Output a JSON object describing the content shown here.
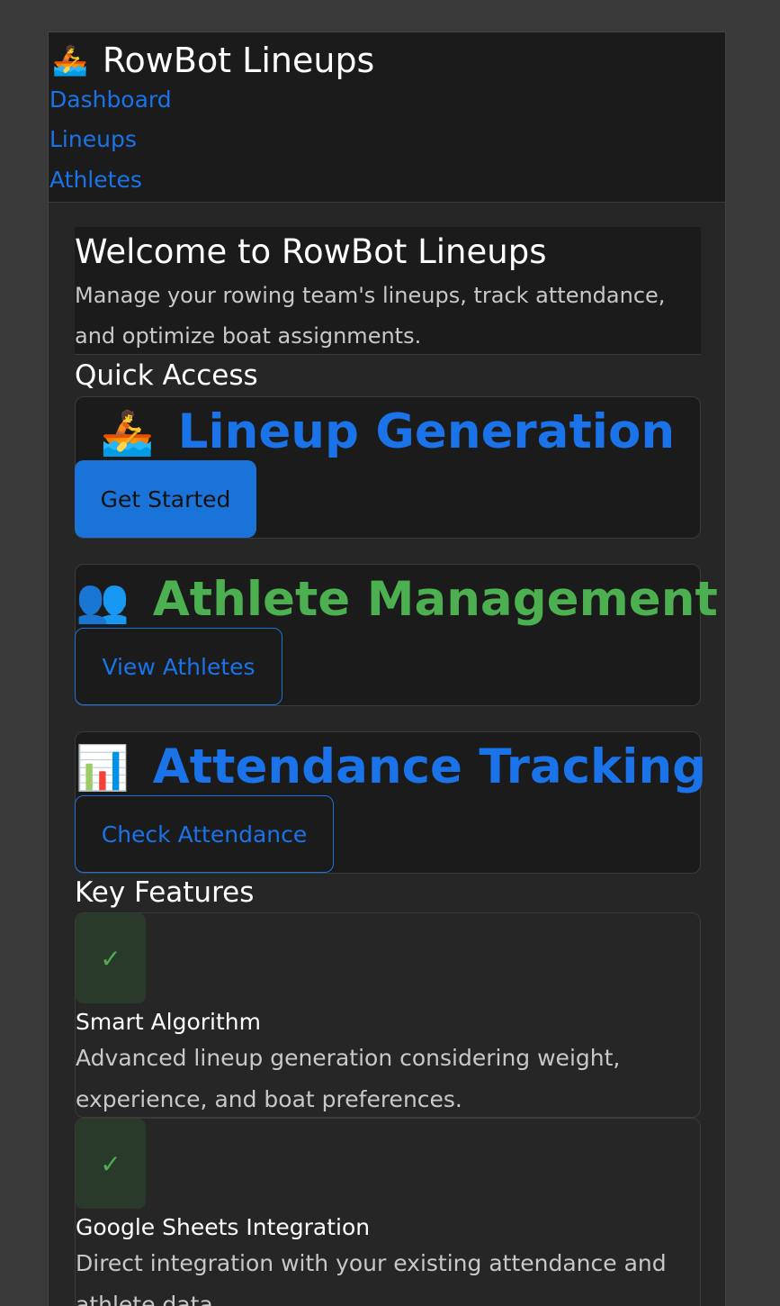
{
  "header": {
    "brand_emoji": "🚣",
    "brand_title": "RowBot Lineups",
    "nav": [
      "Dashboard",
      "Lineups",
      "Athletes"
    ]
  },
  "welcome": {
    "title": "Welcome to RowBot Lineups",
    "subtitle": "Manage your rowing team's lineups, track attendance, and optimize boat assignments."
  },
  "quick_access": {
    "title": "Quick Access",
    "cards": [
      {
        "emoji": "🚣",
        "title": "Lineup Generation",
        "button": "Get Started",
        "color": "#1a73e8"
      },
      {
        "emoji": "👥",
        "title": "Athlete Management",
        "button": "View Athletes",
        "color": "#4caf50"
      },
      {
        "emoji": "📊",
        "title": "Attendance Tracking",
        "button": "Check Attendance",
        "color": "#1a73e8"
      }
    ]
  },
  "key_features": {
    "title": "Key Features",
    "items": [
      {
        "icon": "✓",
        "title": "Smart Algorithm",
        "description": "Advanced lineup generation considering weight, experience, and boat preferences."
      },
      {
        "icon": "✓",
        "title": "Google Sheets Integration",
        "description": "Direct integration with your existing attendance and athlete data."
      }
    ]
  },
  "colors": {
    "accent_blue": "#1a73e8",
    "accent_green": "#4caf50",
    "panel": "#1b1b1b",
    "background": "#262626"
  }
}
